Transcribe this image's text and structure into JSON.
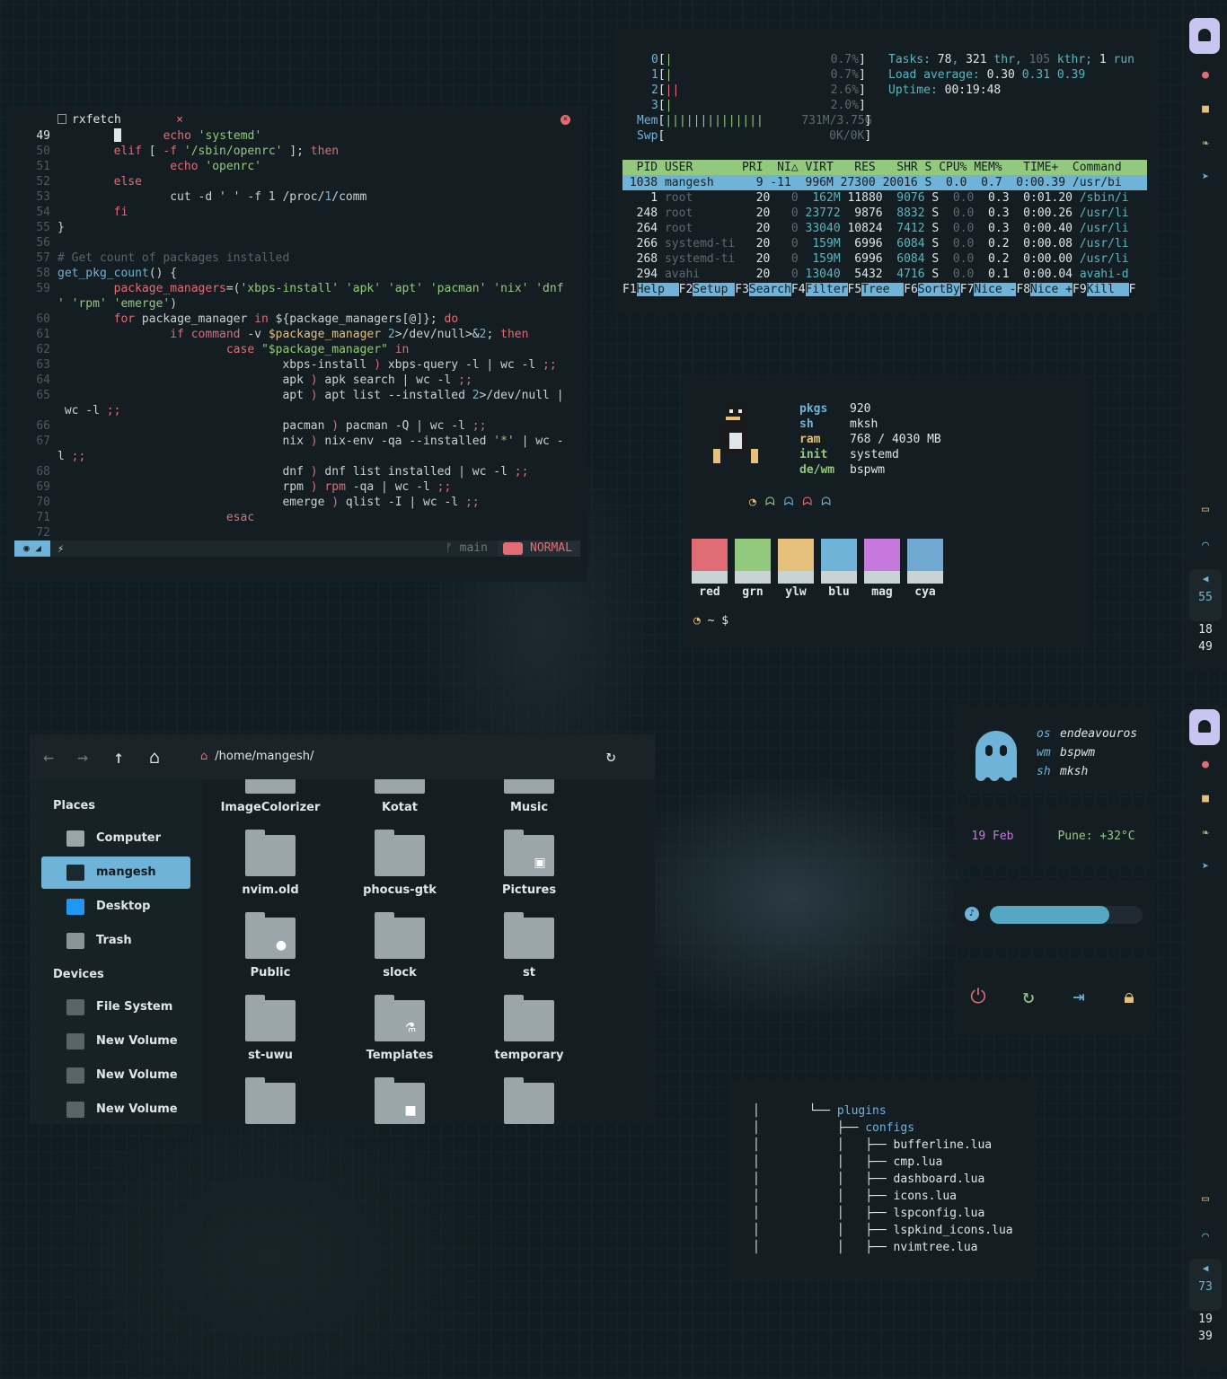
{
  "editor": {
    "tab_title": "rxfetch",
    "tab_close": "×",
    "lines": [
      {
        "n": "49",
        "cur": true,
        "segs": [
          [
            "pl",
            "        "
          ],
          [
            "cursor",
            ""
          ],
          [
            "pl",
            "      "
          ],
          [
            "kw",
            "echo "
          ],
          [
            "st",
            "'systemd'"
          ]
        ]
      },
      {
        "n": "50",
        "segs": [
          [
            "pl",
            "        "
          ],
          [
            "kw",
            "elif"
          ],
          [
            "pl",
            " [ "
          ],
          [
            "kw",
            "-f"
          ],
          [
            "pl",
            " "
          ],
          [
            "st",
            "'/sbin/openrc'"
          ],
          [
            "pl",
            " ]; "
          ],
          [
            "kw",
            "then"
          ]
        ]
      },
      {
        "n": "51",
        "segs": [
          [
            "pl",
            "                "
          ],
          [
            "kw",
            "echo "
          ],
          [
            "st",
            "'openrc'"
          ]
        ]
      },
      {
        "n": "52",
        "segs": [
          [
            "pl",
            "        "
          ],
          [
            "kw",
            "else"
          ]
        ]
      },
      {
        "n": "53",
        "segs": [
          [
            "pl",
            "                cut -d ' ' -f 1 /proc/"
          ],
          [
            "fn",
            "1"
          ],
          [
            "pl",
            "/comm"
          ]
        ]
      },
      {
        "n": "54",
        "segs": [
          [
            "pl",
            "        "
          ],
          [
            "kw",
            "fi"
          ]
        ]
      },
      {
        "n": "55",
        "segs": [
          [
            "pl",
            "}"
          ]
        ]
      },
      {
        "n": "56",
        "segs": [
          [
            "pl",
            ""
          ]
        ]
      },
      {
        "n": "57",
        "segs": [
          [
            "cm",
            "# Get count of packages installed"
          ]
        ]
      },
      {
        "n": "58",
        "segs": [
          [
            "fn",
            "get_pkg_count"
          ],
          [
            "pl",
            "() {"
          ]
        ]
      },
      {
        "n": "59",
        "segs": [
          [
            "pl",
            "        "
          ],
          [
            "kw",
            "package_managers"
          ],
          [
            "pl",
            "=("
          ],
          [
            "st",
            "'xbps-install' 'apk' 'apt' 'pacman' 'nix' 'dnf"
          ]
        ]
      },
      {
        "n": "",
        "segs": [
          [
            "st",
            "' 'rpm' 'emerge'"
          ],
          [
            "pl",
            ")"
          ]
        ]
      },
      {
        "n": "60",
        "segs": [
          [
            "pl",
            "        "
          ],
          [
            "kw",
            "for"
          ],
          [
            "pl",
            " package_manager "
          ],
          [
            "kw",
            "in"
          ],
          [
            "pl",
            " ${package_managers[@]}; "
          ],
          [
            "kw",
            "do"
          ]
        ]
      },
      {
        "n": "61",
        "segs": [
          [
            "pl",
            "                "
          ],
          [
            "kw",
            "if command"
          ],
          [
            "pl",
            " -v "
          ],
          [
            "yl",
            "$package_manager"
          ],
          [
            "pl",
            " "
          ],
          [
            "fn",
            "2"
          ],
          [
            "pl",
            ">/dev/null>&"
          ],
          [
            "fn",
            "2"
          ],
          [
            "pl",
            "; "
          ],
          [
            "kw",
            "then"
          ]
        ]
      },
      {
        "n": "62",
        "segs": [
          [
            "pl",
            "                        "
          ],
          [
            "kw",
            "case"
          ],
          [
            "pl",
            " "
          ],
          [
            "st",
            "\"$package_manager\""
          ],
          [
            "pl",
            " "
          ],
          [
            "kw",
            "in"
          ]
        ]
      },
      {
        "n": "63",
        "segs": [
          [
            "pl",
            "                                xbps-install "
          ],
          [
            "kw",
            ")"
          ],
          [
            "pl",
            " xbps-query -l | wc -l "
          ],
          [
            "kw",
            ";;"
          ]
        ]
      },
      {
        "n": "64",
        "segs": [
          [
            "pl",
            "                                apk "
          ],
          [
            "kw",
            ")"
          ],
          [
            "pl",
            " apk search | wc -l "
          ],
          [
            "kw",
            ";;"
          ]
        ]
      },
      {
        "n": "65",
        "segs": [
          [
            "pl",
            "                                apt "
          ],
          [
            "kw",
            ")"
          ],
          [
            "pl",
            " apt list --installed "
          ],
          [
            "fn",
            "2"
          ],
          [
            "pl",
            ">/dev/null |"
          ]
        ]
      },
      {
        "n": "",
        "segs": [
          [
            "pl",
            " wc -l "
          ],
          [
            "kw",
            ";;"
          ]
        ]
      },
      {
        "n": "66",
        "segs": [
          [
            "pl",
            "                                pacman "
          ],
          [
            "kw",
            ")"
          ],
          [
            "pl",
            " pacman -Q | wc -l "
          ],
          [
            "kw",
            ";;"
          ]
        ]
      },
      {
        "n": "67",
        "segs": [
          [
            "pl",
            "                                nix "
          ],
          [
            "kw",
            ")"
          ],
          [
            "pl",
            " nix-env -qa --installed "
          ],
          [
            "st",
            "'*'"
          ],
          [
            "pl",
            " | wc -"
          ]
        ]
      },
      {
        "n": "",
        "segs": [
          [
            "pl",
            "l "
          ],
          [
            "kw",
            ";;"
          ]
        ]
      },
      {
        "n": "68",
        "segs": [
          [
            "pl",
            "                                dnf "
          ],
          [
            "kw",
            ")"
          ],
          [
            "pl",
            " dnf list installed | wc -l "
          ],
          [
            "kw",
            ";;"
          ]
        ]
      },
      {
        "n": "69",
        "segs": [
          [
            "pl",
            "                                rpm "
          ],
          [
            "kw",
            ")"
          ],
          [
            "pl",
            " "
          ],
          [
            "kw",
            "rpm"
          ],
          [
            "pl",
            " -qa | wc -l "
          ],
          [
            "kw",
            ";;"
          ]
        ]
      },
      {
        "n": "70",
        "segs": [
          [
            "pl",
            "                                emerge "
          ],
          [
            "kw",
            ")"
          ],
          [
            "pl",
            " qlist -I | wc -l "
          ],
          [
            "kw",
            ";;"
          ]
        ]
      },
      {
        "n": "71",
        "segs": [
          [
            "pl",
            "                        "
          ],
          [
            "kw",
            "esac"
          ]
        ]
      },
      {
        "n": "72",
        "segs": [
          [
            "pl",
            ""
          ]
        ]
      }
    ],
    "status": {
      "branch": "ᚠ main",
      "mode": "NORMAL"
    }
  },
  "htop": {
    "cpus": [
      {
        "label": "0",
        "pct": "0.7%"
      },
      {
        "label": "1",
        "pct": "0.7%"
      },
      {
        "label": "2",
        "pct": "2.6%"
      },
      {
        "label": "3",
        "pct": "2.0%"
      }
    ],
    "mem": {
      "label": "Mem",
      "value": "731M/3.75G"
    },
    "swp": {
      "label": "Swp",
      "value": "0K/0K"
    },
    "tasks": {
      "label": "Tasks: ",
      "n1": "78",
      "sep": ", ",
      "n2": "321",
      "thr": " thr, ",
      "n3": "105",
      "kthr": " kthr; ",
      "n4": "1",
      "run": " run"
    },
    "load": {
      "label": "Load average: ",
      "a": "0.30",
      "b": "0.31",
      "c": "0.39"
    },
    "uptime": {
      "label": "Uptime: ",
      "value": "00:19:48"
    },
    "header": "  PID USER       PRI  NI△ VIRT   RES   SHR S CPU% MEM%   TIME+  Command",
    "selected": " 1038 mangesh      9 -11  996M 27300 20016 S  0.0  0.7  0:00.39 /usr/bi",
    "rows": [
      {
        "pid": "    1",
        "user": "root      ",
        "pri": "20",
        "ni": "  0",
        "virt": "  162M",
        "res": "11880",
        "shr": "  9076",
        "s": "S",
        "cpu": "0.0",
        "mem": "0.3",
        "time": "0:01.20",
        "cmd": "/sbin/i"
      },
      {
        "pid": "  248",
        "user": "root      ",
        "pri": "20",
        "ni": "  0",
        "virt": " 23772",
        "res": " 9876",
        "shr": "  8832",
        "s": "S",
        "cpu": "0.0",
        "mem": "0.3",
        "time": "0:00.26",
        "cmd": "/usr/li"
      },
      {
        "pid": "  264",
        "user": "root      ",
        "pri": "20",
        "ni": "  0",
        "virt": " 33040",
        "res": "10824",
        "shr": "  7412",
        "s": "S",
        "cpu": "0.0",
        "mem": "0.3",
        "time": "0:00.40",
        "cmd": "/usr/li"
      },
      {
        "pid": "  266",
        "user": "systemd-ti",
        "pri": "20",
        "ni": "  0",
        "virt": "  159M",
        "res": " 6996",
        "shr": "  6084",
        "s": "S",
        "cpu": "0.0",
        "mem": "0.2",
        "time": "0:00.08",
        "cmd": "/usr/li"
      },
      {
        "pid": "  268",
        "user": "systemd-ti",
        "pri": "20",
        "ni": "  0",
        "virt": "  159M",
        "res": " 6996",
        "shr": "  6084",
        "s": "S",
        "cpu": "0.0",
        "mem": "0.2",
        "time": "0:00.00",
        "cmd": "/usr/li"
      },
      {
        "pid": "  294",
        "user": "avahi     ",
        "pri": "20",
        "ni": "  0",
        "virt": " 13040",
        "res": " 5432",
        "shr": "  4716",
        "s": "S",
        "cpu": "0.0",
        "mem": "0.1",
        "time": "0:00.04",
        "cmd": "avahi-d"
      }
    ],
    "fkeys": [
      {
        "k": "F1",
        "l": "Help  "
      },
      {
        "k": "F2",
        "l": "Setup "
      },
      {
        "k": "F3",
        "l": "Search"
      },
      {
        "k": "F4",
        "l": "Filter"
      },
      {
        "k": "F5",
        "l": "Tree  "
      },
      {
        "k": "F6",
        "l": "SortBy"
      },
      {
        "k": "F7",
        "l": "Nice -"
      },
      {
        "k": "F8",
        "l": "Nice +"
      },
      {
        "k": "F9",
        "l": "Kill  "
      },
      {
        "k": "F",
        "l": ""
      }
    ]
  },
  "fetch": {
    "info": [
      {
        "k": "pkgs",
        "v": "920",
        "color": "#6fb3d8"
      },
      {
        "k": "sh",
        "v": "mksh",
        "color": "#6fb3d8"
      },
      {
        "k": "ram",
        "v": "768 / 4030 MB",
        "color": "#e5c07b"
      },
      {
        "k": "init",
        "v": "systemd",
        "color": "#93c97d"
      },
      {
        "k": "de/wm",
        "v": "bspwm",
        "color": "#93c97d"
      }
    ],
    "swatches": [
      {
        "label": "red",
        "color": "#e06c75"
      },
      {
        "label": "grn",
        "color": "#93c97d"
      },
      {
        "label": "ylw",
        "color": "#e5c07b"
      },
      {
        "label": "blu",
        "color": "#6fb3d8"
      },
      {
        "label": "mag",
        "color": "#c678dd"
      },
      {
        "label": "cya",
        "color": "#6fa8d0"
      }
    ],
    "prompt": "~ $"
  },
  "fm": {
    "path": "/home/mangesh/",
    "places_header": "Places",
    "devices_header": "Devices",
    "places": [
      {
        "label": "Computer",
        "icon": "computer-icon"
      },
      {
        "label": "mangesh",
        "icon": "home-icon",
        "active": true
      },
      {
        "label": "Desktop",
        "icon": "desktop-icon"
      },
      {
        "label": "Trash",
        "icon": "trash-icon"
      }
    ],
    "devices": [
      {
        "label": "File System",
        "icon": "drive-icon"
      },
      {
        "label": "New Volume",
        "icon": "drive-icon"
      },
      {
        "label": "New Volume",
        "icon": "drive-icon"
      },
      {
        "label": "New Volume",
        "icon": "drive-icon"
      }
    ],
    "items": [
      {
        "label": "ImageColorizer",
        "emblem": ""
      },
      {
        "label": "Kotat",
        "emblem": ""
      },
      {
        "label": "Music",
        "emblem": ""
      },
      {
        "label": "nvim.old",
        "emblem": ""
      },
      {
        "label": "phocus-gtk",
        "emblem": ""
      },
      {
        "label": "Pictures",
        "emblem": "picture"
      },
      {
        "label": "Public",
        "emblem": "user"
      },
      {
        "label": "slock",
        "emblem": ""
      },
      {
        "label": "st",
        "emblem": ""
      },
      {
        "label": "st-uwu",
        "emblem": ""
      },
      {
        "label": "Templates",
        "emblem": "template"
      },
      {
        "label": "temporary",
        "emblem": ""
      },
      {
        "label": "",
        "emblem": ""
      },
      {
        "label": "",
        "emblem": "video"
      },
      {
        "label": "",
        "emblem": ""
      }
    ]
  },
  "profile": {
    "rows": [
      {
        "k": "os",
        "v": "endeavouros"
      },
      {
        "k": "wm",
        "v": "bspwm"
      },
      {
        "k": "sh",
        "v": "mksh"
      }
    ],
    "date": "19 Feb",
    "weather": "Pune: +32°C",
    "volume_level": 0.78
  },
  "tree": {
    "lines": [
      {
        "prefix": "│       └── ",
        "name": "plugins",
        "dir": true
      },
      {
        "prefix": "│           ├── ",
        "name": "configs",
        "dir": true
      },
      {
        "prefix": "│           │   ├── ",
        "name": "bufferline.lua",
        "dir": false
      },
      {
        "prefix": "│           │   ├── ",
        "name": "cmp.lua",
        "dir": false
      },
      {
        "prefix": "│           │   ├── ",
        "name": "dashboard.lua",
        "dir": false
      },
      {
        "prefix": "│           │   ├── ",
        "name": "icons.lua",
        "dir": false
      },
      {
        "prefix": "│           │   ├── ",
        "name": "lspconfig.lua",
        "dir": false
      },
      {
        "prefix": "│           │   ├── ",
        "name": "lspkind_icons.lua",
        "dir": false
      },
      {
        "prefix": "│           │   ├── ",
        "name": "nvimtree.lua",
        "dir": false
      }
    ]
  },
  "bar_top": {
    "volume": "55",
    "hour": "18",
    "minute": "49"
  },
  "bar_bottom": {
    "volume": "73",
    "hour": "19",
    "minute": "39"
  },
  "colors": {
    "accent": "#6fb3d8",
    "red": "#e06c75",
    "green": "#93c97d",
    "yellow": "#e5c07b"
  }
}
